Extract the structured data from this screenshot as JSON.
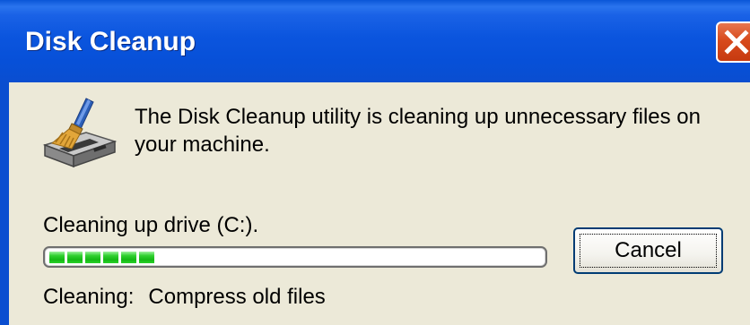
{
  "window": {
    "title": "Disk Cleanup",
    "title_bar_color": "#0a56d8",
    "client_background": "#ece9d8"
  },
  "title_bar": {
    "close_icon": "close-icon"
  },
  "main": {
    "app_icon": "disk-cleanup-icon",
    "description": "The Disk Cleanup utility is cleaning up unnecessary files on your machine.",
    "drive_label": "Cleaning up drive  (C:).",
    "progress": {
      "fraction": 0.22,
      "segments_filled": 6,
      "color": "#14b814"
    },
    "cancel_label": "Cancel",
    "status_label": "Cleaning:",
    "status_value": "Compress old files"
  }
}
